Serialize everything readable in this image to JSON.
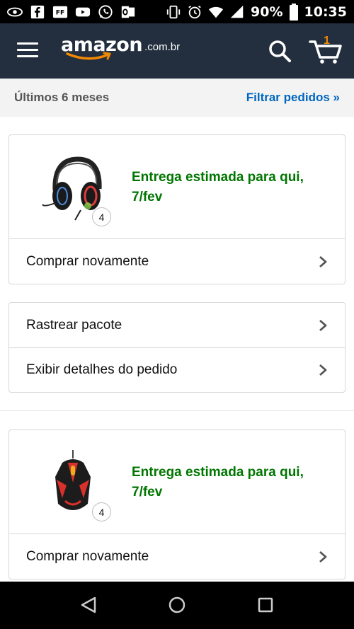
{
  "status_bar": {
    "battery": "90%",
    "time": "10:35",
    "icons": [
      "whatsapp-eye-icon",
      "facebook-icon",
      "ff-icon",
      "youtube-icon",
      "whatsapp-icon",
      "outlook-icon",
      "vibrate-icon",
      "alarm-icon",
      "wifi-icon",
      "signal-icon",
      "battery-icon"
    ],
    "ff_label": "FF"
  },
  "header": {
    "logo_word": "amazon",
    "logo_domain": ".com.br",
    "cart_count": "1",
    "colors": {
      "background": "#232f3e",
      "accent": "#f08804"
    }
  },
  "filter_bar": {
    "range": "Últimos 6 meses",
    "filter_link": "Filtrar pedidos »"
  },
  "orders": [
    {
      "product_icon": "headset-image",
      "quantity": "4",
      "delivery": "Entrega estimada para qui, 7/fev",
      "buy_again": "Comprar novamente",
      "actions": [
        "Rastrear pacote",
        "Exibir detalhes do pedido"
      ]
    },
    {
      "product_icon": "gaming-mouse-image",
      "quantity": "4",
      "delivery": "Entrega estimada para qui, 7/fev",
      "buy_again": "Comprar novamente"
    }
  ],
  "colors": {
    "delivery_green": "#007600",
    "link_blue": "#0066c0"
  }
}
